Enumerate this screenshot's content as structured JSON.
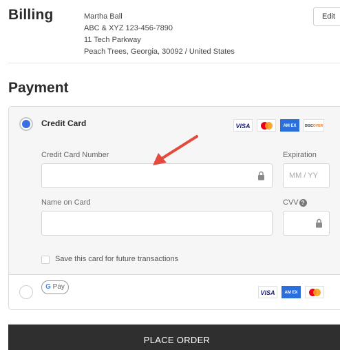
{
  "billing": {
    "title": "Billing",
    "name": "Martha Ball",
    "company_phone": "ABC & XYZ 123-456-7890",
    "street": "11 Tech Parkway",
    "city_line": "Peach Trees, Georgia, 30092 / United States",
    "edit_label": "Edit"
  },
  "payment": {
    "title": "Payment",
    "credit_card": {
      "label": "Credit Card",
      "selected": true,
      "logos": {
        "visa": "VISA",
        "amex": "AM EX",
        "discover_prefix": "DISC",
        "discover_suffix": "OVER"
      },
      "number_label": "Credit Card Number",
      "number_value": "",
      "expiration_label": "Expiration",
      "expiration_placeholder": "MM / YY",
      "name_label": "Name on Card",
      "name_value": "",
      "cvv_label": "CVV",
      "cvv_info_symbol": "?",
      "save_card_label": "Save this card for future transactions",
      "save_card_checked": false
    },
    "google_pay": {
      "badge_g": "G",
      "badge_text": "Pay",
      "selected": false,
      "logos": {
        "visa": "VISA",
        "amex": "AM EX"
      }
    }
  },
  "place_order_label": "PLACE ORDER",
  "colors": {
    "radio_selected": "#3b6fe0",
    "button_bg": "#2f2f2f",
    "annotation_arrow": "#e34b3e"
  },
  "icons": {
    "lock": "lock-icon",
    "info": "info-icon",
    "annotation": "red-arrow-icon"
  }
}
